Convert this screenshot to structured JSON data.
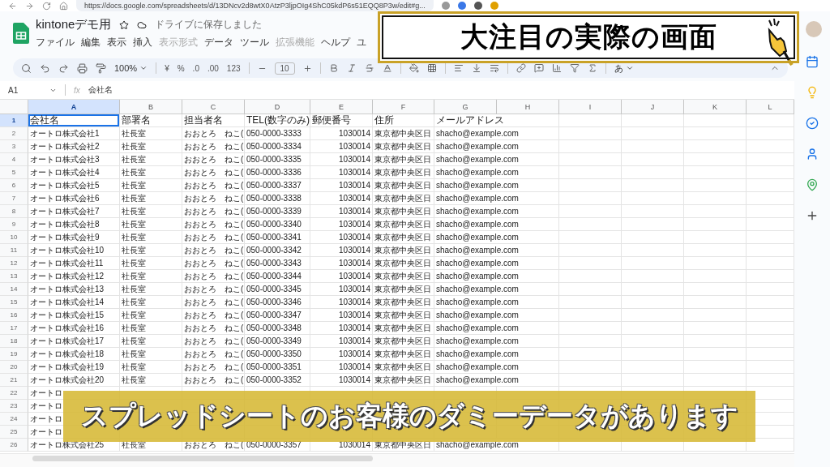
{
  "browser": {
    "url": "https://docs.google.com/spreadsheets/d/13DNcv2d8wtX0AtzP3ljpOIg4ShC05kdP6s51EQQ8P3w/edit#g..."
  },
  "document": {
    "title": "kintoneデモ用",
    "save_status": "ドライブに保存しました"
  },
  "menu": [
    {
      "label": "ファイル",
      "disabled": false
    },
    {
      "label": "編集",
      "disabled": false
    },
    {
      "label": "表示",
      "disabled": false
    },
    {
      "label": "挿入",
      "disabled": false
    },
    {
      "label": "表示形式",
      "disabled": true
    },
    {
      "label": "データ",
      "disabled": false
    },
    {
      "label": "ツール",
      "disabled": false
    },
    {
      "label": "拡張機能",
      "disabled": true
    },
    {
      "label": "ヘルプ",
      "disabled": false
    },
    {
      "label": "ユ",
      "disabled": false
    }
  ],
  "toolbar": {
    "zoom": "100%",
    "currency": "¥",
    "percent": "%",
    "decrease_decimal": ".0",
    "increase_decimal": ".00",
    "number_format": "123",
    "font_size": "10",
    "input_tool": "あ"
  },
  "formula_bar": {
    "cell_ref": "A1",
    "function_label": "fx",
    "value": "会社名"
  },
  "sheet": {
    "columns": [
      {
        "label": "A",
        "selected": true
      },
      {
        "label": "B",
        "selected": false
      },
      {
        "label": "C",
        "selected": false
      },
      {
        "label": "D",
        "selected": false
      },
      {
        "label": "E",
        "selected": false
      },
      {
        "label": "F",
        "selected": false
      },
      {
        "label": "G",
        "selected": false
      },
      {
        "label": "H",
        "selected": false
      },
      {
        "label": "I",
        "selected": false
      },
      {
        "label": "J",
        "selected": false
      },
      {
        "label": "K",
        "selected": false
      },
      {
        "label": "L",
        "selected": false
      }
    ],
    "rows": [
      {
        "number": "1",
        "selected": true,
        "kind": "header",
        "cells": [
          "会社名",
          "部署名",
          "担当者名",
          "TEL(数字のみ)",
          "郵便番号",
          "住所",
          "メールアドレス"
        ]
      },
      {
        "number": "2",
        "selected": false,
        "kind": "data",
        "cells": [
          "オートロ株式会社1",
          "社長室",
          "おおとろ　ねこ(",
          "050-0000-3333",
          "1030014",
          "東京都中央区日",
          "shacho@example.com"
        ]
      },
      {
        "number": "3",
        "selected": false,
        "kind": "data",
        "cells": [
          "オートロ株式会社2",
          "社長室",
          "おおとろ　ねこ(",
          "050-0000-3334",
          "1030014",
          "東京都中央区日",
          "shacho@example.com"
        ]
      },
      {
        "number": "4",
        "selected": false,
        "kind": "data",
        "cells": [
          "オートロ株式会社3",
          "社長室",
          "おおとろ　ねこ(",
          "050-0000-3335",
          "1030014",
          "東京都中央区日",
          "shacho@example.com"
        ]
      },
      {
        "number": "5",
        "selected": false,
        "kind": "data",
        "cells": [
          "オートロ株式会社4",
          "社長室",
          "おおとろ　ねこ(",
          "050-0000-3336",
          "1030014",
          "東京都中央区日",
          "shacho@example.com"
        ]
      },
      {
        "number": "6",
        "selected": false,
        "kind": "data",
        "cells": [
          "オートロ株式会社5",
          "社長室",
          "おおとろ　ねこ(",
          "050-0000-3337",
          "1030014",
          "東京都中央区日",
          "shacho@example.com"
        ]
      },
      {
        "number": "7",
        "selected": false,
        "kind": "data",
        "cells": [
          "オートロ株式会社6",
          "社長室",
          "おおとろ　ねこ(",
          "050-0000-3338",
          "1030014",
          "東京都中央区日",
          "shacho@example.com"
        ]
      },
      {
        "number": "8",
        "selected": false,
        "kind": "data",
        "cells": [
          "オートロ株式会社7",
          "社長室",
          "おおとろ　ねこ(",
          "050-0000-3339",
          "1030014",
          "東京都中央区日",
          "shacho@example.com"
        ]
      },
      {
        "number": "9",
        "selected": false,
        "kind": "data",
        "cells": [
          "オートロ株式会社8",
          "社長室",
          "おおとろ　ねこ(",
          "050-0000-3340",
          "1030014",
          "東京都中央区日",
          "shacho@example.com"
        ]
      },
      {
        "number": "10",
        "selected": false,
        "kind": "data",
        "cells": [
          "オートロ株式会社9",
          "社長室",
          "おおとろ　ねこ(",
          "050-0000-3341",
          "1030014",
          "東京都中央区日",
          "shacho@example.com"
        ]
      },
      {
        "number": "11",
        "selected": false,
        "kind": "data",
        "cells": [
          "オートロ株式会社10",
          "社長室",
          "おおとろ　ねこ(",
          "050-0000-3342",
          "1030014",
          "東京都中央区日",
          "shacho@example.com"
        ]
      },
      {
        "number": "12",
        "selected": false,
        "kind": "data",
        "cells": [
          "オートロ株式会社11",
          "社長室",
          "おおとろ　ねこ(",
          "050-0000-3343",
          "1030014",
          "東京都中央区日",
          "shacho@example.com"
        ]
      },
      {
        "number": "13",
        "selected": false,
        "kind": "data",
        "cells": [
          "オートロ株式会社12",
          "社長室",
          "おおとろ　ねこ(",
          "050-0000-3344",
          "1030014",
          "東京都中央区日",
          "shacho@example.com"
        ]
      },
      {
        "number": "14",
        "selected": false,
        "kind": "data",
        "cells": [
          "オートロ株式会社13",
          "社長室",
          "おおとろ　ねこ(",
          "050-0000-3345",
          "1030014",
          "東京都中央区日",
          "shacho@example.com"
        ]
      },
      {
        "number": "15",
        "selected": false,
        "kind": "data",
        "cells": [
          "オートロ株式会社14",
          "社長室",
          "おおとろ　ねこ(",
          "050-0000-3346",
          "1030014",
          "東京都中央区日",
          "shacho@example.com"
        ]
      },
      {
        "number": "16",
        "selected": false,
        "kind": "data",
        "cells": [
          "オートロ株式会社15",
          "社長室",
          "おおとろ　ねこ(",
          "050-0000-3347",
          "1030014",
          "東京都中央区日",
          "shacho@example.com"
        ]
      },
      {
        "number": "17",
        "selected": false,
        "kind": "data",
        "cells": [
          "オートロ株式会社16",
          "社長室",
          "おおとろ　ねこ(",
          "050-0000-3348",
          "1030014",
          "東京都中央区日",
          "shacho@example.com"
        ]
      },
      {
        "number": "18",
        "selected": false,
        "kind": "data",
        "cells": [
          "オートロ株式会社17",
          "社長室",
          "おおとろ　ねこ(",
          "050-0000-3349",
          "1030014",
          "東京都中央区日",
          "shacho@example.com"
        ]
      },
      {
        "number": "19",
        "selected": false,
        "kind": "data",
        "cells": [
          "オートロ株式会社18",
          "社長室",
          "おおとろ　ねこ(",
          "050-0000-3350",
          "1030014",
          "東京都中央区日",
          "shacho@example.com"
        ]
      },
      {
        "number": "20",
        "selected": false,
        "kind": "data",
        "cells": [
          "オートロ株式会社19",
          "社長室",
          "おおとろ　ねこ(",
          "050-0000-3351",
          "1030014",
          "東京都中央区日",
          "shacho@example.com"
        ]
      },
      {
        "number": "21",
        "selected": false,
        "kind": "data",
        "cells": [
          "オートロ株式会社20",
          "社長室",
          "おおとろ　ねこ(",
          "050-0000-3352",
          "1030014",
          "東京都中央区日",
          "shacho@example.com"
        ]
      },
      {
        "number": "22",
        "selected": false,
        "kind": "data",
        "cells": [
          "オートロ"
        ]
      },
      {
        "number": "23",
        "selected": false,
        "kind": "data",
        "cells": [
          "オートロ"
        ]
      },
      {
        "number": "24",
        "selected": false,
        "kind": "data",
        "cells": [
          "オートロ"
        ]
      },
      {
        "number": "25",
        "selected": false,
        "kind": "data",
        "cells": [
          "オートロ"
        ]
      },
      {
        "number": "26",
        "selected": false,
        "kind": "data",
        "cells": [
          "オートロ株式会社25",
          "社長室",
          "おおとろ　ねこ(",
          "050-0000-3357",
          "1030014",
          "東京都中央区日",
          "shacho@example.com"
        ]
      }
    ]
  },
  "overlay": {
    "banner": "大注目の実際の画面",
    "caption": "スプレッドシートのお客様のダミーデータがあります"
  }
}
